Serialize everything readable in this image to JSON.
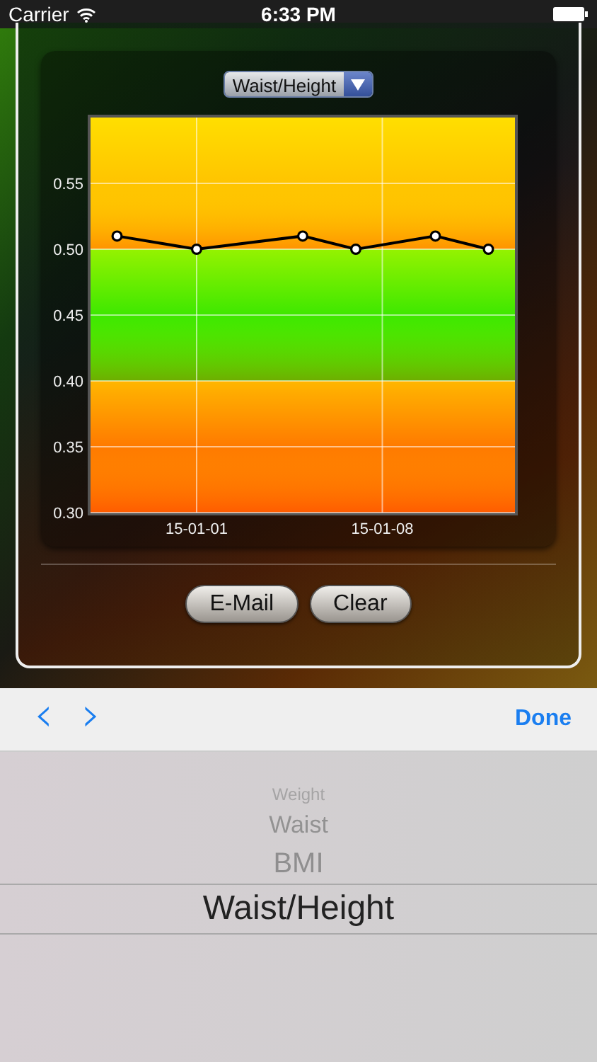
{
  "status_bar": {
    "carrier": "Carrier",
    "time": "6:33 PM"
  },
  "chart_panel": {
    "metric_dropdown": {
      "value": "Waist/Height"
    },
    "chart_data": {
      "type": "line",
      "categories": [
        null,
        null,
        null,
        "15-01-01",
        null,
        null,
        null,
        null,
        null,
        null,
        "15-01-08",
        null,
        null,
        null,
        null
      ],
      "ylim": [
        0.3,
        0.6
      ],
      "yticks": [
        {
          "value": 0.3,
          "label": "0.30"
        },
        {
          "value": 0.35,
          "label": "0.35"
        },
        {
          "value": 0.4,
          "label": "0.40"
        },
        {
          "value": 0.45,
          "label": "0.45"
        },
        {
          "value": 0.5,
          "label": "0.50"
        },
        {
          "value": 0.55,
          "label": "0.55"
        }
      ],
      "grid": true,
      "bands": [
        {
          "axis": "y",
          "from": 0.3,
          "to": 0.4,
          "color": "#ff7a00"
        },
        {
          "axis": "y",
          "from": 0.4,
          "to": 0.5,
          "color": "#3ee800"
        },
        {
          "axis": "y",
          "from": 0.5,
          "to": 0.6,
          "color": "#ffc400"
        }
      ],
      "series": [
        {
          "color": "#000000",
          "marker": "circle",
          "values": [
            0.51,
            null,
            null,
            0.5,
            null,
            null,
            null,
            0.51,
            null,
            0.5,
            null,
            null,
            0.51,
            null,
            0.5
          ]
        }
      ]
    },
    "buttons": [
      "E-Mail",
      "Clear"
    ]
  },
  "keyboard_toolbar": {
    "previous": "‹",
    "next": "›",
    "done": "Done"
  },
  "picker": {
    "items": [
      {
        "label": "Weight",
        "selected": false
      },
      {
        "label": "Waist",
        "selected": false
      },
      {
        "label": "BMI",
        "selected": false
      },
      {
        "label": "Waist/Height",
        "selected": true
      }
    ]
  }
}
